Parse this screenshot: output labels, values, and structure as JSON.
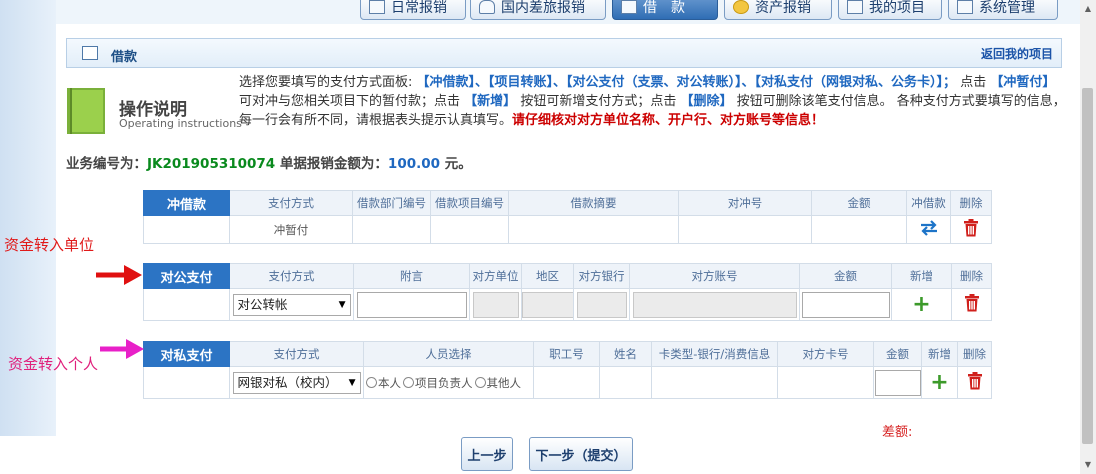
{
  "nav": {
    "tabs": [
      {
        "label": "日常报销",
        "icon": "document-icon"
      },
      {
        "label": "国内差旅报销",
        "icon": "train-icon"
      },
      {
        "label": "借　款",
        "icon": "loan-icon",
        "active": true
      },
      {
        "label": "资产报销",
        "icon": "coins-icon"
      },
      {
        "label": "我的项目",
        "icon": "folder-icon"
      },
      {
        "label": "系统管理",
        "icon": "settings-icon"
      }
    ]
  },
  "section": {
    "title": "借款",
    "back_link": "返回我的项目"
  },
  "instructions": {
    "title": "操作说明",
    "subtitle": "Operating instructions",
    "p1": "选择您要填写的支付方式面板:",
    "h1": "【冲借款】、【项目转账】、【对公支付（支票、对公转账）】、【对私支付（网银对私、公务卡）】；",
    "p2": "点击",
    "h2": "【冲暂付】",
    "p3": "可对冲与您相关项目下的暂付款；点击",
    "h3": "【新增】",
    "p4": "按钮可新增支付方式；点击",
    "h4": "【删除】",
    "p5": "按钮可删除该笔支付信息。 各种支付方式要填写的信息，每一行会有所不同，请根据表头提示认真填写。",
    "warn": "请仔细核对对方单位名称、开户行、对方账号等信息！"
  },
  "business": {
    "id_label": "业务编号为：",
    "id": "JK201905310074",
    "amount_label": "单据报销金额为：",
    "amount": "100.00",
    "unit": "元。"
  },
  "offset_table": {
    "title": "冲借款",
    "headers": [
      "支付方式",
      "借款部门编号",
      "借款项目编号",
      "借款摘要",
      "对冲号",
      "金额",
      "冲借款",
      "删除"
    ],
    "row": {
      "method": "冲暂付"
    }
  },
  "public_table": {
    "title": "对公支付",
    "headers": [
      "支付方式",
      "附言",
      "对方单位",
      "地区",
      "对方银行",
      "对方账号",
      "金额",
      "新增",
      "删除"
    ],
    "row": {
      "method": "对公转帐"
    }
  },
  "private_table": {
    "title": "对私支付",
    "headers": [
      "支付方式",
      "人员选择",
      "职工号",
      "姓名",
      "卡类型-银行/消费信息",
      "对方卡号",
      "金额",
      "新增",
      "删除"
    ],
    "row": {
      "method": "网银对私（校内）",
      "radios": [
        "本人",
        "项目负责人",
        "其他人"
      ]
    }
  },
  "annotations": {
    "public": "资金转入单位",
    "private": "资金转入个人"
  },
  "footer": {
    "diff_label": "差额:",
    "prev": "上一步",
    "next": "下一步（提交）"
  },
  "colors": {
    "accent": "#2c74c4",
    "warning": "#cc0000",
    "id_green": "#0a8a1e",
    "annotation_red": "#e01a1a",
    "annotation_magenta": "#e0207c"
  }
}
